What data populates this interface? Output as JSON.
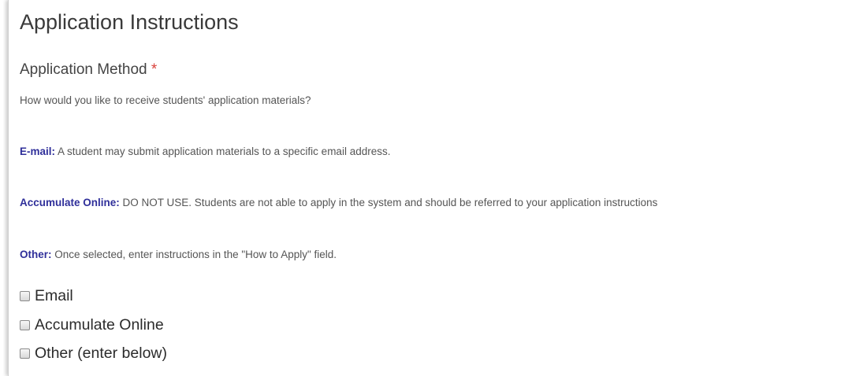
{
  "title": "Application Instructions",
  "method": {
    "label": "Application Method",
    "required_mark": "*",
    "question": "How would you like to receive students' application materials?"
  },
  "descriptions": [
    {
      "term": "E-mail:",
      "text": " A student may submit application materials to a specific email address."
    },
    {
      "term": "Accumulate Online:",
      "text": " DO NOT USE. Students are not able to apply in the system and should be referred to your application instructions"
    },
    {
      "term": "Other:",
      "text": " Once selected, enter instructions in the \"How to Apply\" field."
    }
  ],
  "options": [
    {
      "label": "Email",
      "checked": false
    },
    {
      "label": "Accumulate Online",
      "checked": false
    },
    {
      "label": "Other (enter below)",
      "checked": false
    }
  ],
  "colors": {
    "term": "#2f2f9a",
    "required": "#d9423b"
  }
}
